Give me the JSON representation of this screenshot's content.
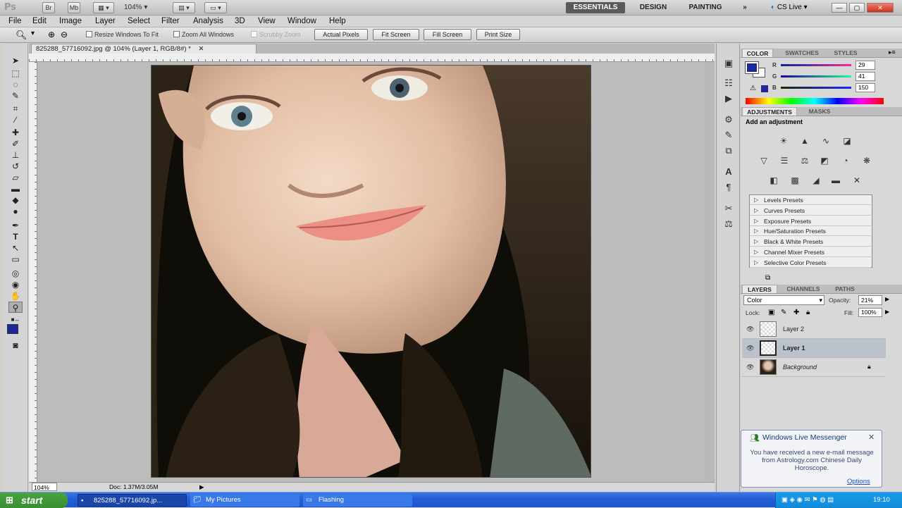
{
  "appbar": {
    "logo": "Ps",
    "br_label": "Br",
    "mb_label": "Mb",
    "zoom": "104%",
    "workspaces": [
      "ESSENTIALS",
      "DESIGN",
      "PAINTING"
    ],
    "more": "»",
    "cslive": "CS Live"
  },
  "menu": [
    "File",
    "Edit",
    "Image",
    "Layer",
    "Select",
    "Filter",
    "Analysis",
    "3D",
    "View",
    "Window",
    "Help"
  ],
  "options": {
    "resize_windows": "Resize Windows To Fit",
    "zoom_all": "Zoom All Windows",
    "scrubby": "Scrubby Zoom",
    "actual_pixels": "Actual Pixels",
    "fit_screen": "Fit Screen",
    "fill_screen": "Fill Screen",
    "print_size": "Print Size"
  },
  "document": {
    "tab_title": "825288_57716092.jpg @ 104% (Layer 1, RGB/8#) *",
    "status_zoom": "104%",
    "status_doc": "Doc: 1.37M/3.05M"
  },
  "color_panel": {
    "tabs": [
      "COLOR",
      "SWATCHES",
      "STYLES"
    ],
    "foreground": "#1d2996",
    "r_label": "R",
    "g_label": "G",
    "b_label": "B",
    "r": "29",
    "g": "41",
    "b": "150"
  },
  "adjustments": {
    "tabs": [
      "ADJUSTMENTS",
      "MASKS"
    ],
    "heading": "Add an adjustment",
    "presets": [
      "Levels Presets",
      "Curves Presets",
      "Exposure Presets",
      "Hue/Saturation Presets",
      "Black & White Presets",
      "Channel Mixer Presets",
      "Selective Color Presets"
    ]
  },
  "layers": {
    "tabs": [
      "LAYERS",
      "CHANNELS",
      "PATHS"
    ],
    "blend_mode": "Color",
    "opacity_label": "Opacity:",
    "opacity": "21%",
    "lock_label": "Lock:",
    "fill_label": "Fill:",
    "fill": "100%",
    "items": [
      {
        "name": "Layer 2"
      },
      {
        "name": "Layer 1"
      },
      {
        "name": "Background"
      }
    ]
  },
  "messenger": {
    "title": "Windows Live Messenger",
    "body": "You have received a new e-mail message from Astrology.com Chinese Daily Horoscope.",
    "options": "Options"
  },
  "taskbar": {
    "start": "start",
    "tasks": [
      "825288_57716092.jp...",
      "My Pictures",
      "Flashing"
    ],
    "time": "19:10"
  }
}
